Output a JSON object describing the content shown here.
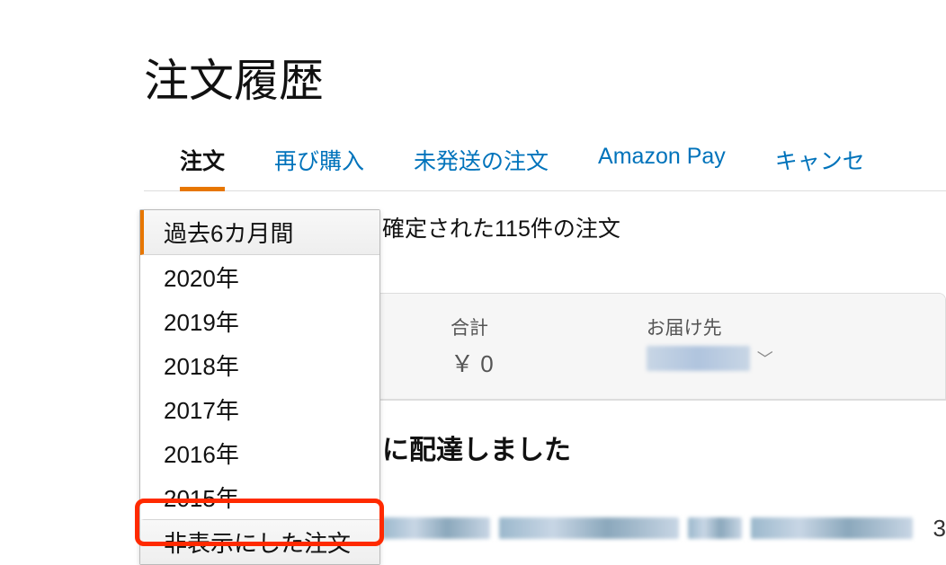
{
  "page_title": "注文履歴",
  "tabs": [
    {
      "label": "注文",
      "active": true
    },
    {
      "label": "再び購入",
      "active": false
    },
    {
      "label": "未発送の注文",
      "active": false
    },
    {
      "label": "Amazon Pay",
      "active": false
    },
    {
      "label": "キャンセ",
      "active": false
    }
  ],
  "summary": "確定された115件の注文",
  "dropdown": {
    "items": [
      {
        "label": "過去6カ月間",
        "selected": true,
        "highlighted": false
      },
      {
        "label": "2020年",
        "selected": false,
        "highlighted": false
      },
      {
        "label": "2019年",
        "selected": false,
        "highlighted": false
      },
      {
        "label": "2018年",
        "selected": false,
        "highlighted": false
      },
      {
        "label": "2017年",
        "selected": false,
        "highlighted": false
      },
      {
        "label": "2016年",
        "selected": false,
        "highlighted": false
      },
      {
        "label": "2015年",
        "selected": false,
        "highlighted": false
      },
      {
        "label": "非表示にした注文",
        "selected": false,
        "highlighted": true
      }
    ]
  },
  "order_card": {
    "total_label": "合計",
    "total_value": "￥ 0",
    "shipping_label": "お届け先"
  },
  "delivery_status_partial": "に配達しました",
  "trailing_char": "3"
}
